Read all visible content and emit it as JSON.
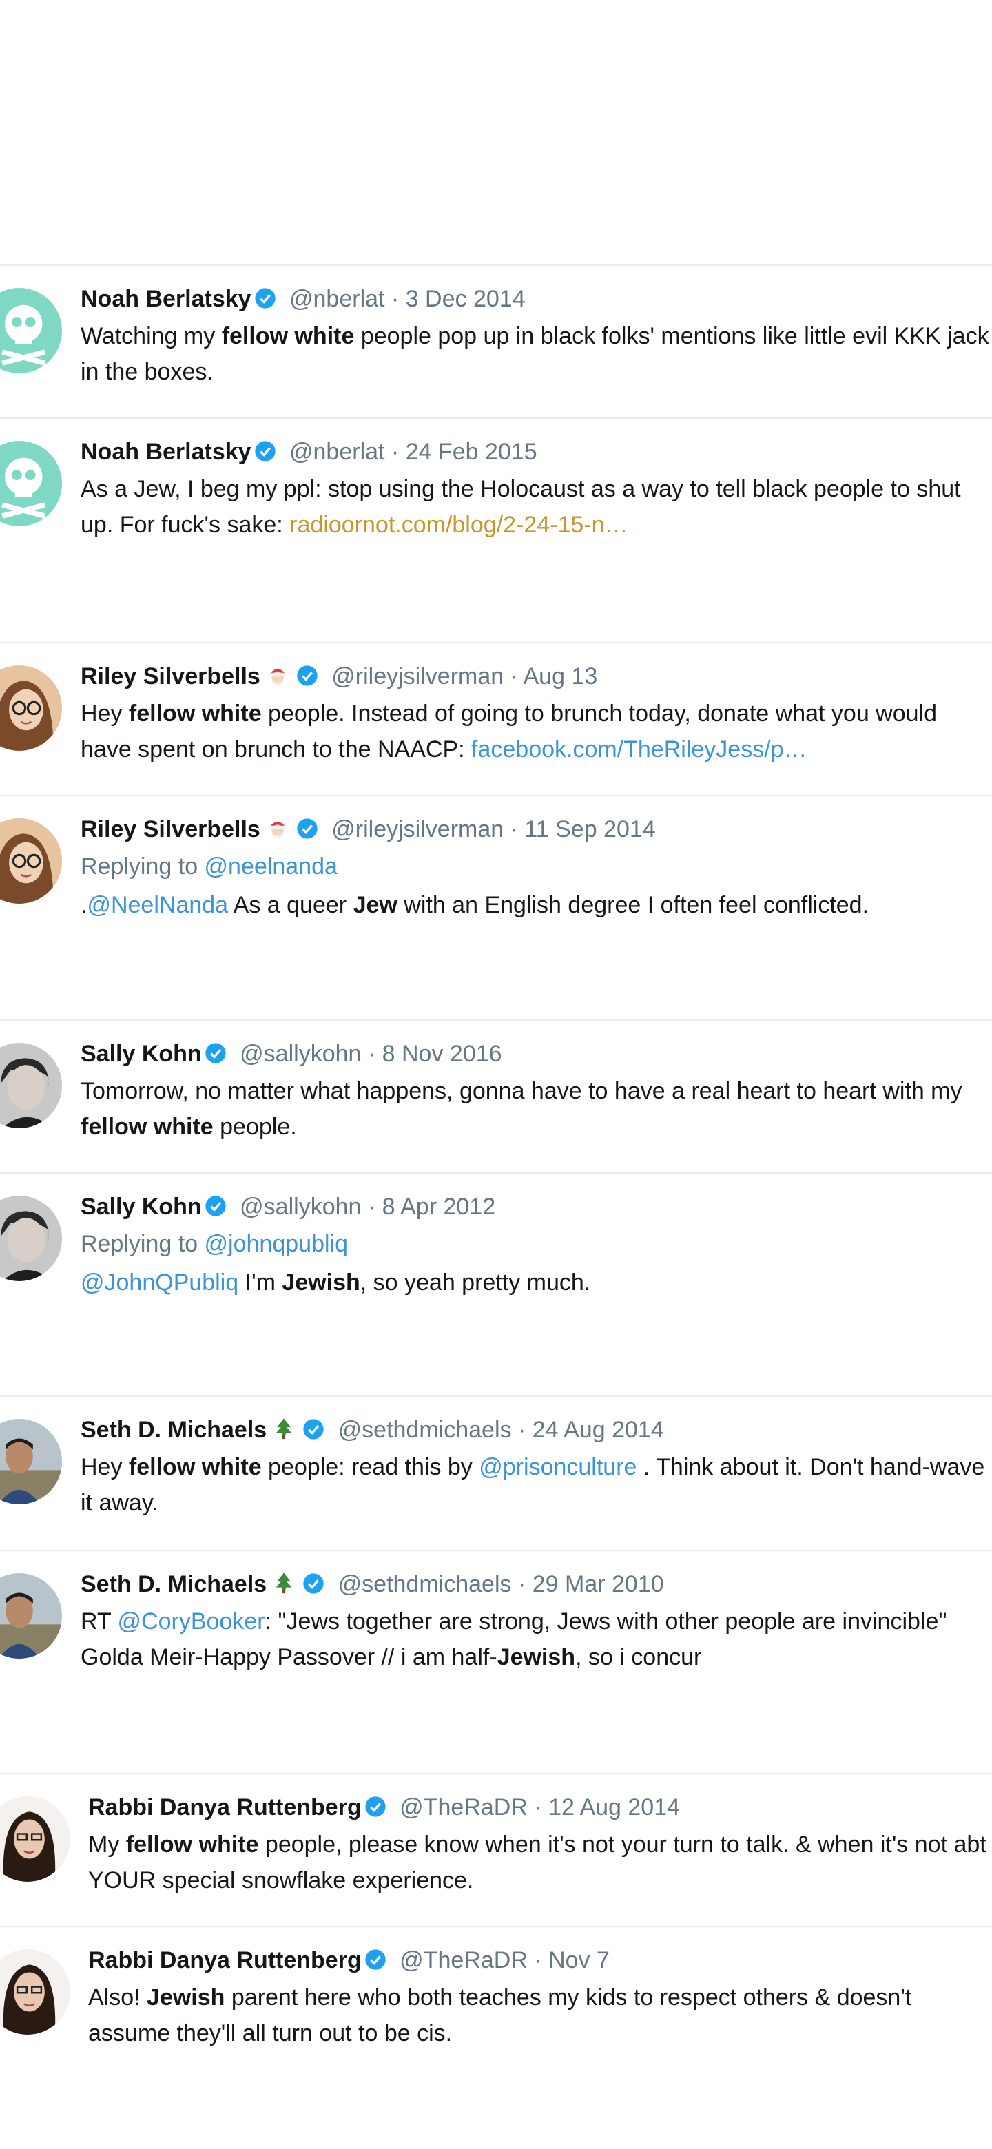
{
  "tweets": [
    {
      "name": "Noah Berlatsky",
      "handle": "@nberlat",
      "date": "3 Dec 2014",
      "text_parts": [
        "Watching my ",
        "fellow white",
        " people pop up in black folks' mentions like little evil KKK jack in the boxes."
      ]
    },
    {
      "name": "Noah Berlatsky",
      "handle": "@nberlat",
      "date": "24 Feb 2015",
      "text_parts": [
        "As a Jew, I beg my ppl: stop using the Holocaust as a way to tell black people to shut up. For fuck's sake: ",
        "radioornot.com/blog/2-24-15-n…"
      ]
    },
    {
      "name": "Riley Silverbells",
      "handle": "@rileyjsilverman",
      "date": "Aug 13",
      "text_parts": [
        "Hey ",
        "fellow white",
        " people. Instead of going to brunch today, donate what you would have spent on brunch to the NAACP: ",
        "facebook.com/TheRileyJess/p…"
      ]
    },
    {
      "name": "Riley Silverbells",
      "handle": "@rileyjsilverman",
      "date": "11 Sep 2014",
      "reply_label": "Replying to ",
      "reply_handle": "@neelnanda",
      "text_parts": [
        ".",
        "@NeelNanda",
        " As a queer ",
        "Jew",
        " with an English degree I often feel conflicted."
      ]
    },
    {
      "name": "Sally Kohn",
      "handle": "@sallykohn",
      "date": "8 Nov 2016",
      "text_parts": [
        "Tomorrow, no matter what happens, gonna have to have a real heart to heart with my ",
        "fellow white",
        " people."
      ]
    },
    {
      "name": "Sally Kohn",
      "handle": "@sallykohn",
      "date": "8 Apr 2012",
      "reply_label": "Replying to ",
      "reply_handle": "@johnqpubliq",
      "text_parts": [
        "@JohnQPubliq",
        " I'm ",
        "Jewish",
        ", so yeah pretty much."
      ]
    },
    {
      "name": "Seth D. Michaels",
      "handle": "@sethdmichaels",
      "date": "24 Aug 2014",
      "text_parts": [
        "Hey ",
        "fellow white",
        " people: read this by ",
        "@prisonculture",
        " . Think about it. Don't hand-wave it away."
      ]
    },
    {
      "name": "Seth D. Michaels",
      "handle": "@sethdmichaels",
      "date": "29 Mar 2010",
      "text_parts": [
        "RT ",
        "@CoryBooker",
        ": \"Jews together are strong, Jews with other people are invincible\" Golda Meir-Happy Passover // i am half-",
        "Jewish",
        ", so i concur"
      ]
    },
    {
      "name": "Rabbi Danya Ruttenberg",
      "handle": "@TheRaDR",
      "date": "12 Aug 2014",
      "text_parts": [
        "My ",
        "fellow white",
        " people, please know when it's not your turn to talk. & when it's not abt YOUR special snowflake experience."
      ]
    },
    {
      "name": "Rabbi Danya Ruttenberg",
      "handle": "@TheRaDR",
      "date": "Nov 7",
      "text_parts": [
        "Also! ",
        "Jewish",
        " parent here who both teaches my kids to respect others & doesn't assume they'll all turn out to be cis."
      ]
    }
  ],
  "separator": " · ",
  "colors": {
    "link": "#3b94d9",
    "link_gold": "#c9962a",
    "muted": "#657786",
    "divider": "#e6ecf0",
    "verified": "#1da1f2"
  },
  "icons": {
    "verified": "verified-badge-icon",
    "santa": "santa-emoji-icon",
    "tree": "christmas-tree-emoji-icon"
  }
}
